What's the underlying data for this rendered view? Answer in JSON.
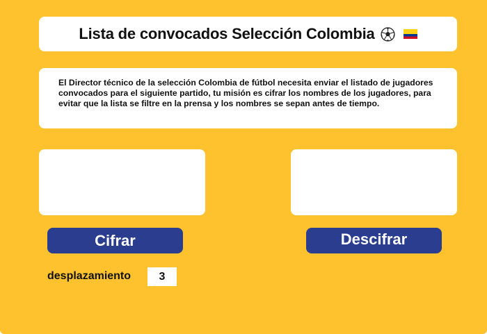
{
  "header": {
    "title": "Lista de convocados Selección Colombia",
    "icons": [
      "soccer-ball-icon",
      "colombia-flag-icon"
    ]
  },
  "description": {
    "text": "El Director técnico de la selección Colombia de fútbol necesita enviar el listado de jugadores convocados para el siguiente partido, tu misión es cifrar los nombres de los jugadores,  para evitar que la lista se filtre en la prensa y los nombres se sepan antes de tiempo."
  },
  "input": {
    "value": "",
    "placeholder": ""
  },
  "output": {
    "value": "",
    "placeholder": ""
  },
  "buttons": {
    "cipher_label": "Cifrar",
    "decipher_label": "Descifrar"
  },
  "shift": {
    "label": "desplazamiento",
    "value": "3"
  },
  "colors": {
    "background": "#fec22e",
    "panel": "#ffffff",
    "button": "#2a3d8f",
    "button_text": "#ffffff",
    "flag_yellow": "#fcd116",
    "flag_blue": "#003893",
    "flag_red": "#ce1126"
  }
}
